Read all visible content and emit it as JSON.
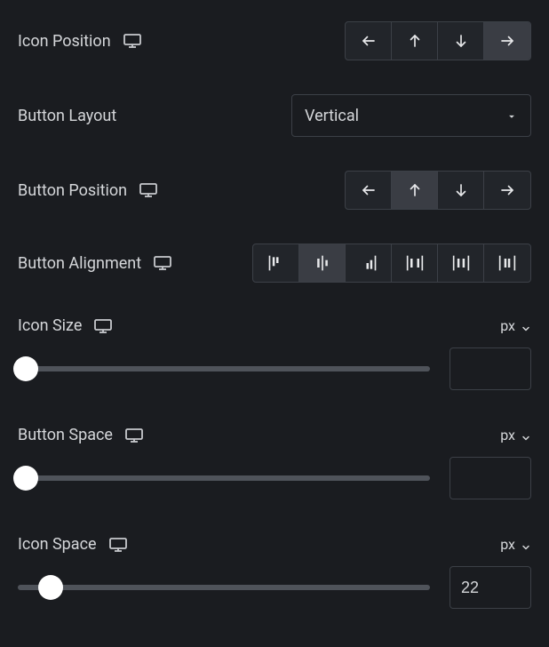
{
  "iconPosition": {
    "label": "Icon Position",
    "selectedIndex": 3
  },
  "buttonLayout": {
    "label": "Button Layout",
    "value": "Vertical"
  },
  "buttonPosition": {
    "label": "Button Position",
    "selectedIndex": 1
  },
  "buttonAlignment": {
    "label": "Button Alignment",
    "selectedIndex": 1
  },
  "iconSize": {
    "label": "Icon Size",
    "unit": "px",
    "value": "",
    "percent": 2
  },
  "buttonSpace": {
    "label": "Button Space",
    "unit": "px",
    "value": "",
    "percent": 2
  },
  "iconSpace": {
    "label": "Icon Space",
    "unit": "px",
    "value": "22",
    "percent": 8
  }
}
